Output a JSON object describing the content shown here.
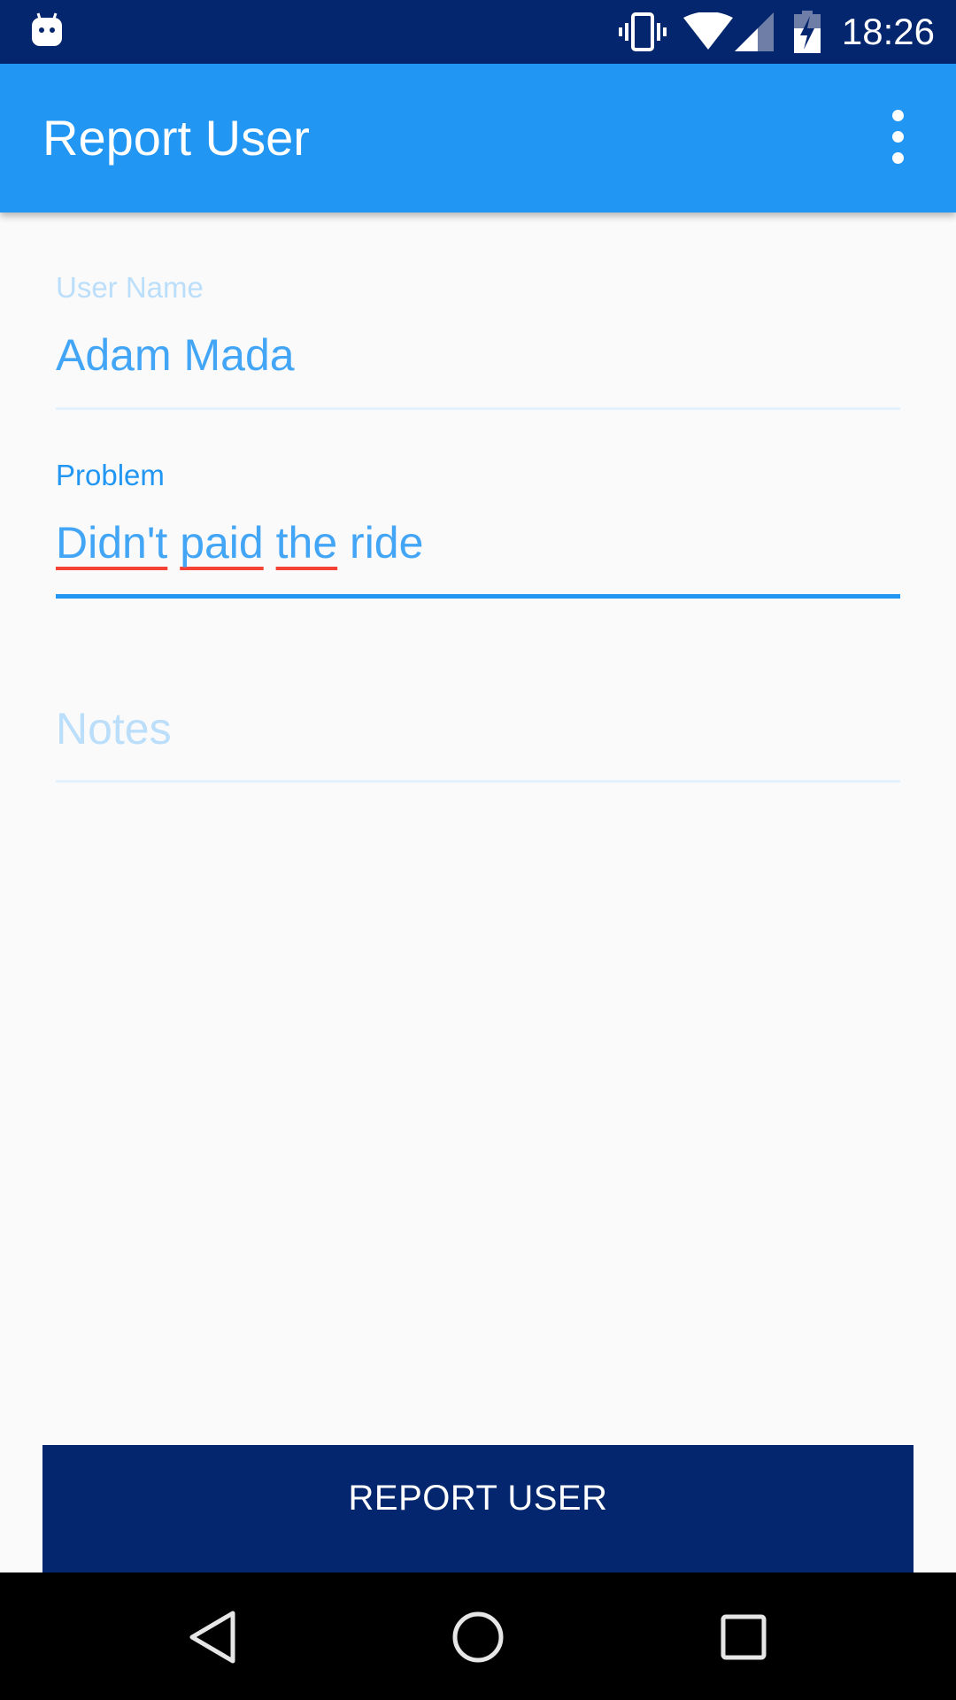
{
  "status_bar": {
    "time": "18:26",
    "icons": [
      "android-bot-icon",
      "vibrate-icon",
      "wifi-icon",
      "signal-icon",
      "battery-charging-icon"
    ]
  },
  "app_bar": {
    "title": "Report User",
    "overflow_icon": "more-vert-icon"
  },
  "form": {
    "username": {
      "label": "User Name",
      "value": "Adam Mada"
    },
    "problem": {
      "label": "Problem",
      "value": "Didn't paid the ride",
      "words": [
        "Didn't",
        "paid",
        "the",
        "ride"
      ]
    },
    "notes": {
      "placeholder": "Notes"
    }
  },
  "button": {
    "label": "REPORT USER"
  },
  "nav_bar": {
    "icons": [
      "back-icon",
      "home-icon",
      "recents-icon"
    ]
  },
  "colors": {
    "status_bar": "#04266e",
    "app_bar": "#2196f3",
    "accent": "#2196f3",
    "button": "#04266e",
    "spell_underline": "#f44336"
  }
}
